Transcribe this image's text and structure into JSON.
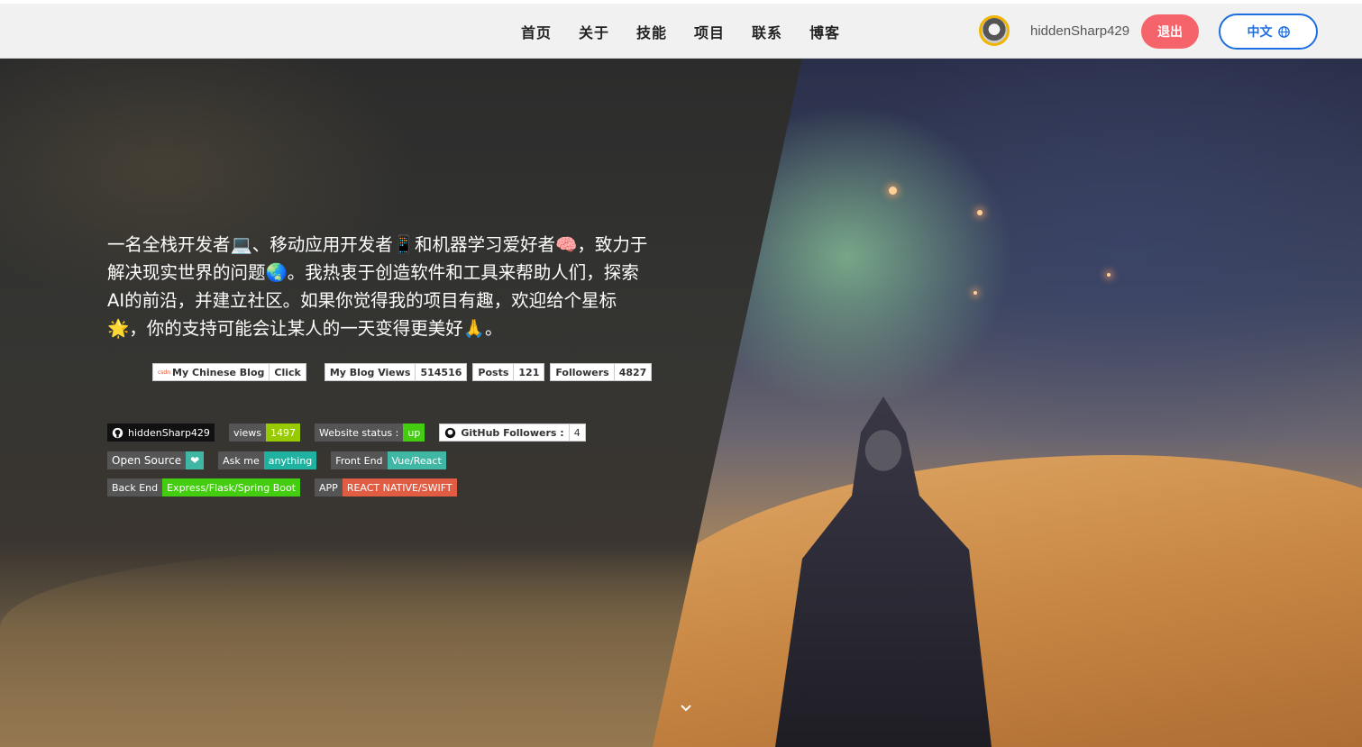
{
  "nav": {
    "items": [
      "首页",
      "关于",
      "技能",
      "项目",
      "联系",
      "博客"
    ]
  },
  "user": {
    "username": "hiddenSharp429",
    "logout_label": "退出",
    "language_label": "中文"
  },
  "hero": {
    "intro": "一名全栈开发者💻、移动应用开发者📱和机器学习爱好者🧠，致力于解决现实世界的问题🌏。我热衷于创造软件和工具来帮助人们，探索AI的前沿，并建立社区。如果你觉得我的项目有趣，欢迎给个星标🌟，你的支持可能会让某人的一天变得更美好🙏。"
  },
  "blog_badges": {
    "chinese_blog_logo": "csdn",
    "chinese_blog_label": "My Chinese Blog",
    "chinese_blog_value": "Click",
    "views_label": "My Blog Views",
    "views_value": "514516",
    "posts_label": "Posts",
    "posts_value": "121",
    "followers_label": "Followers",
    "followers_value": "4827"
  },
  "shields": {
    "row1": {
      "github_user": "hiddenSharp429",
      "views_label": "views",
      "views_value": "1497",
      "website_label": "Website status :",
      "website_value": "up",
      "gh_followers_label": "GitHub Followers :",
      "gh_followers_value": "4"
    },
    "row2": {
      "open_source_label": "Open Source",
      "ask_label": "Ask me",
      "ask_value": "anything",
      "frontend_label": "Front End",
      "frontend_value": "Vue/React"
    },
    "row3": {
      "backend_label": "Back End",
      "backend_value": "Express/Flask/Spring Boot",
      "app_label": "APP",
      "app_value": "REACT NATIVE/SWIFT"
    }
  },
  "colors": {
    "logout": "#f5646b",
    "language": "#1d6fe0",
    "shield_green": "#4c1",
    "shield_teal": "#20b2a0",
    "shield_red": "#e05d44"
  },
  "icons": [
    "globe-icon",
    "github-icon",
    "heart-icon",
    "chevron-down-icon"
  ]
}
